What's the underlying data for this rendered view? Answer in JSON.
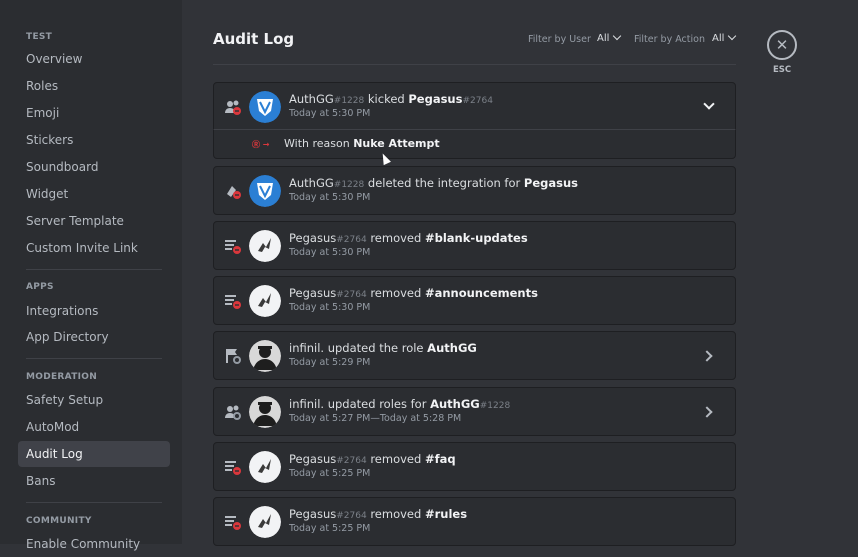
{
  "sidebar": {
    "sections": [
      {
        "title": "TEST",
        "items": [
          "Overview",
          "Roles",
          "Emoji",
          "Stickers",
          "Soundboard",
          "Widget",
          "Server Template",
          "Custom Invite Link"
        ]
      },
      {
        "title": "APPS",
        "items": [
          "Integrations",
          "App Directory"
        ]
      },
      {
        "title": "MODERATION",
        "items": [
          "Safety Setup",
          "AutoMod",
          "Audit Log",
          "Bans"
        ]
      },
      {
        "title": "COMMUNITY",
        "items": [
          "Enable Community"
        ]
      }
    ],
    "active_item": "Audit Log"
  },
  "header": {
    "title": "Audit Log",
    "filter_user_label": "Filter by User",
    "filter_user_value": "All",
    "filter_action_label": "Filter by Action",
    "filter_action_value": "All"
  },
  "close": {
    "label": "ESC",
    "glyph": "✕"
  },
  "entries": [
    {
      "icon": "member-kick-icon",
      "avatar": "authgg",
      "actor": "AuthGG",
      "actor_tag": "#1228",
      "action": " kicked ",
      "target": "Pegasus",
      "target_tag": "#2764",
      "time": "Today at 5:30 PM",
      "expandable": "down"
    },
    {
      "icon": "integration-delete-icon",
      "avatar": "authgg",
      "actor": "AuthGG",
      "actor_tag": "#1228",
      "action": " deleted the integration for ",
      "target": "Pegasus",
      "target_tag": "",
      "time": "Today at 5:30 PM",
      "expandable": ""
    },
    {
      "icon": "channel-delete-icon",
      "avatar": "pegasus",
      "actor": "Pegasus",
      "actor_tag": "#2764",
      "action": " removed ",
      "target": "#blank-updates",
      "target_tag": "",
      "time": "Today at 5:30 PM",
      "expandable": ""
    },
    {
      "icon": "channel-delete-icon",
      "avatar": "pegasus",
      "actor": "Pegasus",
      "actor_tag": "#2764",
      "action": " removed ",
      "target": "#announcements",
      "target_tag": "",
      "time": "Today at 5:30 PM",
      "expandable": ""
    },
    {
      "icon": "role-update-icon",
      "avatar": "infinil",
      "actor": "infinil.",
      "actor_tag": "",
      "action": " updated the role ",
      "target": "AuthGG",
      "target_tag": "",
      "time": "Today at 5:29 PM",
      "expandable": "right"
    },
    {
      "icon": "member-role-update-icon",
      "avatar": "infinil",
      "actor": "infinil.",
      "actor_tag": "",
      "action": " updated roles for ",
      "target": "AuthGG",
      "target_tag": "#1228",
      "time": "Today at 5:27 PM—Today at 5:28 PM",
      "expandable": "right"
    },
    {
      "icon": "channel-delete-icon",
      "avatar": "pegasus",
      "actor": "Pegasus",
      "actor_tag": "#2764",
      "action": " removed ",
      "target": "#faq",
      "target_tag": "",
      "time": "Today at 5:25 PM",
      "expandable": ""
    },
    {
      "icon": "channel-delete-icon",
      "avatar": "pegasus",
      "actor": "Pegasus",
      "actor_tag": "#2764",
      "action": " removed ",
      "target": "#rules",
      "target_tag": "",
      "time": "Today at 5:25 PM",
      "expandable": ""
    }
  ],
  "expanded": {
    "reason_prefix": "With reason ",
    "reason": "Nuke Attempt",
    "reason_icon": "Ⓡ →"
  },
  "colors": {
    "accent": "#da373c",
    "authgg_avatar": "#2b7fd4"
  }
}
